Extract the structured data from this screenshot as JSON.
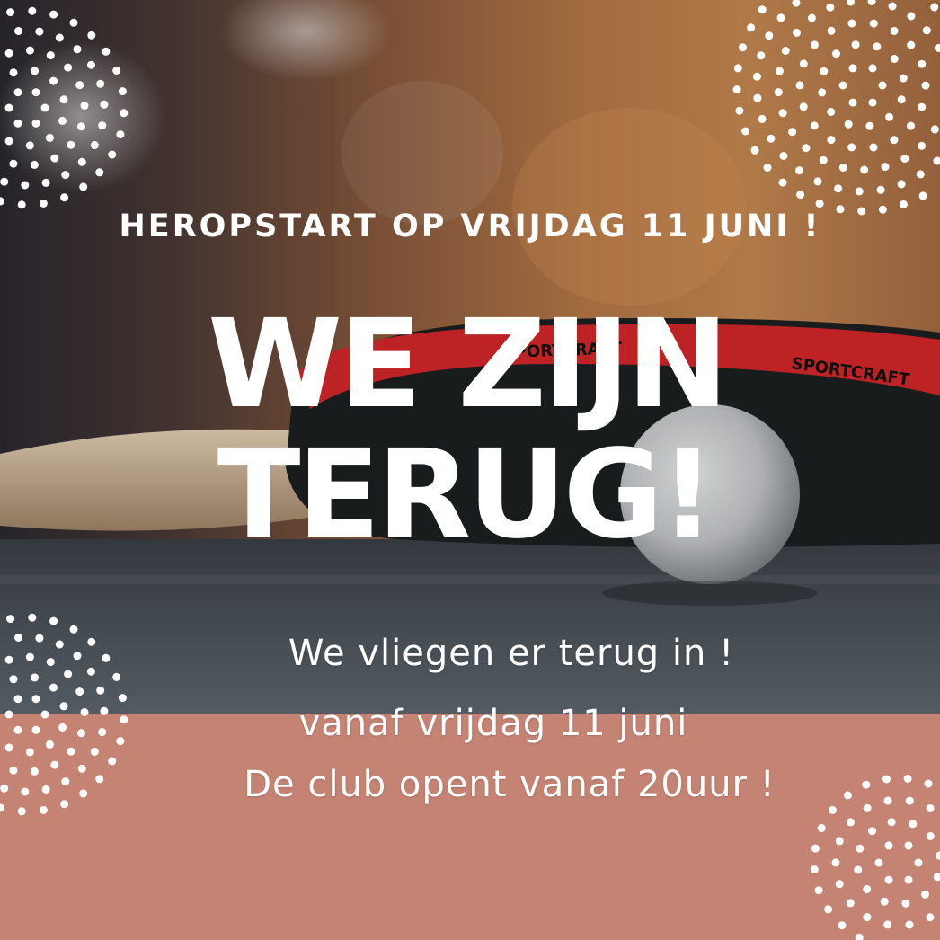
{
  "poster": {
    "subheading": "HEROPSTART OP VRIJDAG 11 JUNI !",
    "headline_line1": "WE ZIJN",
    "headline_line2": "TERUG!",
    "body_lines": [
      "We vliegen er terug in !",
      "vanaf vrijdag 11 juni",
      "De club opent vanaf 20uur !"
    ],
    "racket_brand": "SPORTCRAFT"
  },
  "colors": {
    "accent_panel": "#c58374",
    "text": "#ffffff",
    "racket_edge": "#d8272b"
  },
  "icons": [
    "dot-pattern-icon",
    "table-tennis-racket-icon",
    "ping-pong-ball-icon"
  ]
}
